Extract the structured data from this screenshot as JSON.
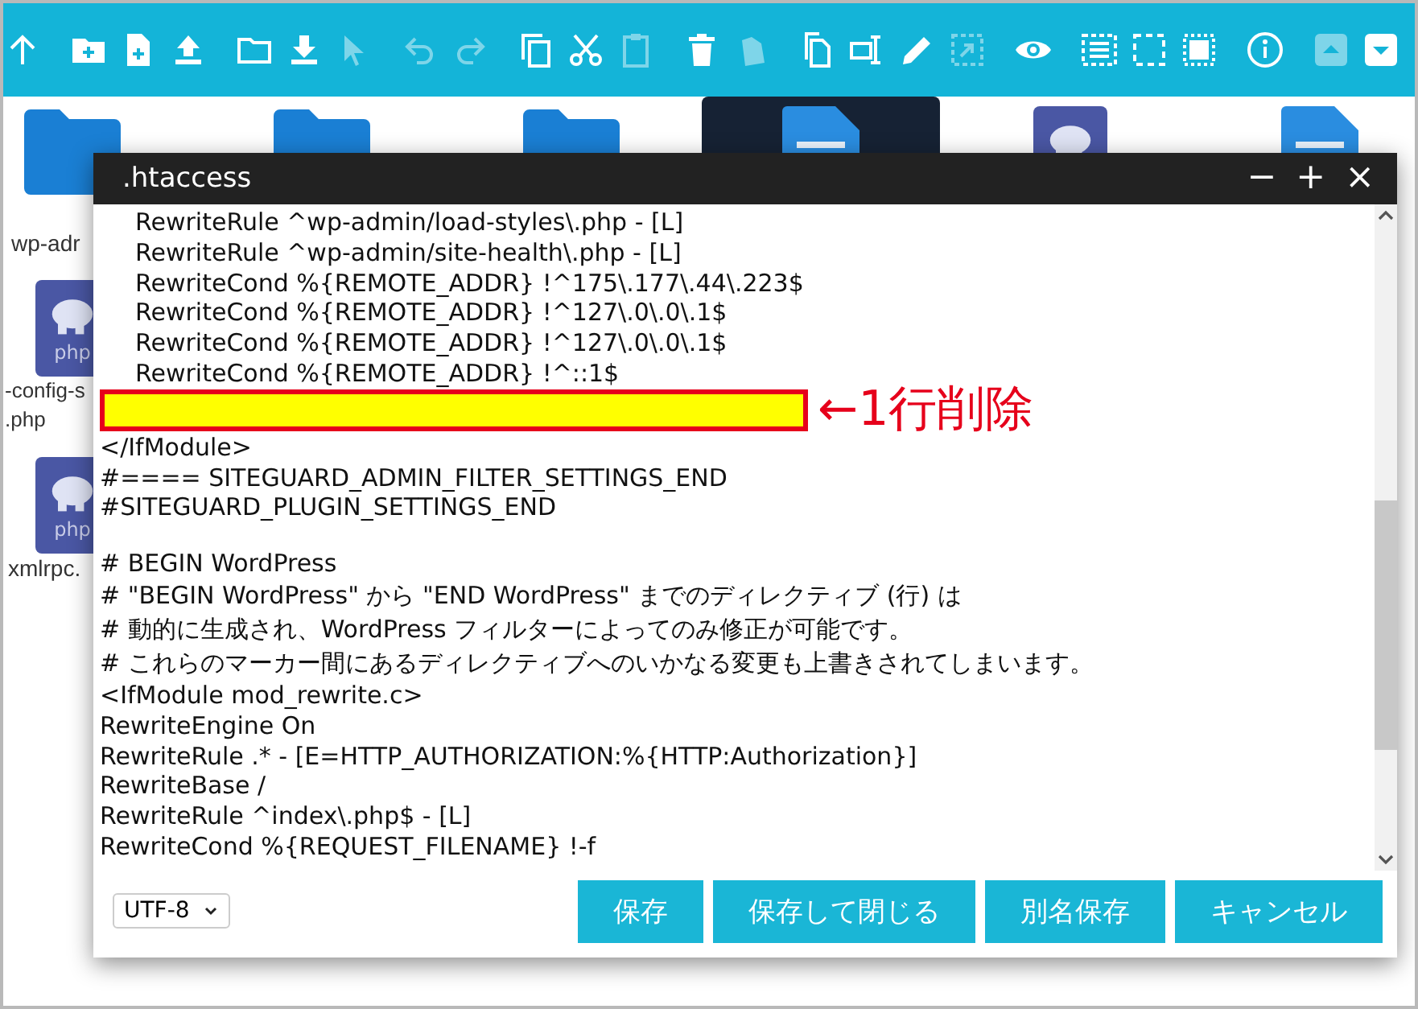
{
  "toolbar": [
    [
      {
        "disabled": false
      }
    ],
    [
      {
        "disabled": false
      },
      {
        "disabled": false
      },
      {
        "disabled": false
      }
    ],
    [
      {
        "disabled": false
      },
      {
        "disabled": false
      },
      {
        "disabled": true
      }
    ],
    [
      {
        "disabled": true
      },
      {
        "disabled": true
      }
    ],
    [
      {
        "disabled": false
      },
      {
        "disabled": false
      },
      {
        "disabled": true
      }
    ],
    [
      {
        "disabled": false
      },
      {
        "disabled": true
      }
    ],
    [
      {
        "disabled": false
      },
      {
        "disabled": false
      },
      {
        "disabled": false
      },
      {
        "disabled": true
      }
    ],
    [
      {
        "disabled": false
      }
    ],
    [
      {
        "disabled": false
      },
      {
        "disabled": false
      },
      {
        "disabled": false
      }
    ],
    [
      {
        "disabled": false
      }
    ],
    [
      {
        "disabled": true
      },
      {
        "disabled": false
      }
    ]
  ],
  "file_grid": {
    "rows": [
      [
        {
          "kind": "folder",
          "selected": false,
          "label": [
            "wp-adr"
          ]
        },
        {
          "kind": "folder",
          "selected": false
        },
        {
          "kind": "folder",
          "selected": false
        },
        {
          "kind": "doc",
          "selected": true
        },
        {
          "kind": "php",
          "selected": false
        },
        {
          "kind": "doc",
          "selected": false
        }
      ],
      [
        {
          "kind": "php",
          "selected": false,
          "icon_text": "php",
          "label": [
            "-config-s",
            ".php"
          ]
        }
      ],
      [
        {
          "kind": "php",
          "selected": false,
          "icon_text": "php",
          "label": [
            "xmlrpc."
          ]
        }
      ]
    ]
  },
  "dialog": {
    "title": ".htaccess",
    "controls": [
      "−",
      "+",
      "×"
    ],
    "lines": [
      {
        "kind": "text",
        "indented": true,
        "text": "RewriteRule ^wp-admin/load-styles\\.php - [L]"
      },
      {
        "kind": "text",
        "indented": true,
        "text": "RewriteRule ^wp-admin/site-health\\.php - [L]"
      },
      {
        "kind": "text",
        "indented": true,
        "text": "RewriteCond %{REMOTE_ADDR} !^175\\.177\\.44\\.223$"
      },
      {
        "kind": "text",
        "indented": true,
        "text": "RewriteCond %{REMOTE_ADDR} !^127\\.0\\.0\\.1$"
      },
      {
        "kind": "text",
        "indented": true,
        "text": "RewriteCond %{REMOTE_ADDR} !^127\\.0\\.0\\.1$"
      },
      {
        "kind": "text",
        "indented": true,
        "text": "RewriteCond %{REMOTE_ADDR} !^::1$"
      },
      {
        "kind": "highlight",
        "note": "←1行削除"
      },
      {
        "kind": "text",
        "indented": false,
        "text": "</IfModule>"
      },
      {
        "kind": "text",
        "indented": false,
        "text": "#==== SITEGUARD_ADMIN_FILTER_SETTINGS_END"
      },
      {
        "kind": "text",
        "indented": false,
        "text": "#SITEGUARD_PLUGIN_SETTINGS_END"
      },
      {
        "kind": "blank"
      },
      {
        "kind": "text",
        "indented": false,
        "text": "# BEGIN WordPress"
      },
      {
        "kind": "text",
        "indented": false,
        "text": "# \"BEGIN WordPress\" から \"END WordPress\" までのディレクティブ (行) は"
      },
      {
        "kind": "text",
        "indented": false,
        "text": "# 動的に生成され、WordPress フィルターによってのみ修正が可能です。"
      },
      {
        "kind": "text",
        "indented": false,
        "text": "# これらのマーカー間にあるディレクティブへのいかなる変更も上書きされてしまいます。"
      },
      {
        "kind": "text",
        "indented": false,
        "text": "<IfModule mod_rewrite.c>"
      },
      {
        "kind": "text",
        "indented": false,
        "text": "RewriteEngine On"
      },
      {
        "kind": "text",
        "indented": false,
        "text": "RewriteRule .* - [E=HTTP_AUTHORIZATION:%{HTTP:Authorization}]"
      },
      {
        "kind": "text",
        "indented": false,
        "text": "RewriteBase /"
      },
      {
        "kind": "text",
        "indented": false,
        "text": "RewriteRule ^index\\.php$ - [L]"
      },
      {
        "kind": "text",
        "indented": false,
        "text": "RewriteCond %{REQUEST_FILENAME} !-f"
      }
    ],
    "encoding": "UTF-8",
    "buttons": [
      "保存",
      "保存して閉じる",
      "別名保存",
      "キャンセル"
    ]
  }
}
